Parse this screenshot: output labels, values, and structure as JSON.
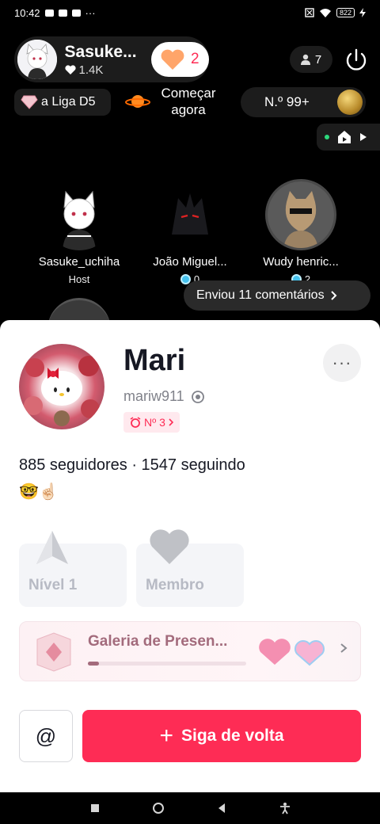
{
  "status_bar": {
    "time": "10:42",
    "dots": "···",
    "battery": "822"
  },
  "host": {
    "name": "Sasuke...",
    "likes": "1.4K",
    "heart_count": "2"
  },
  "viewers": {
    "count": "7"
  },
  "league": {
    "label": "a Liga D5"
  },
  "start": {
    "label": "Começar agora"
  },
  "rank": {
    "label": "N.º 99+"
  },
  "guests": [
    {
      "name": "Sasuke_uchiha",
      "sub": "Host"
    },
    {
      "name": "João Miguel...",
      "sub": "0"
    },
    {
      "name": "Wudy henric...",
      "sub": "2"
    }
  ],
  "comments": {
    "label": "Enviou 11 comentários"
  },
  "profile": {
    "name": "Mari",
    "handle": "mariw911",
    "rank_badge": "Nº 3",
    "stats": "885 seguidores · 1547 seguindo",
    "emojis": "🤓☝🏻",
    "more_label": "···"
  },
  "cards": [
    {
      "label": "Nível 1"
    },
    {
      "label": "Membro"
    }
  ],
  "gallery": {
    "title": "Galeria de Presen...",
    "progress": 0.07
  },
  "actions": {
    "mention": "@",
    "follow": "Siga de volta",
    "plus": "+"
  },
  "colors": {
    "accent": "#fe2c55",
    "sheet_bg": "#ffffff",
    "live_bg": "#000000"
  }
}
